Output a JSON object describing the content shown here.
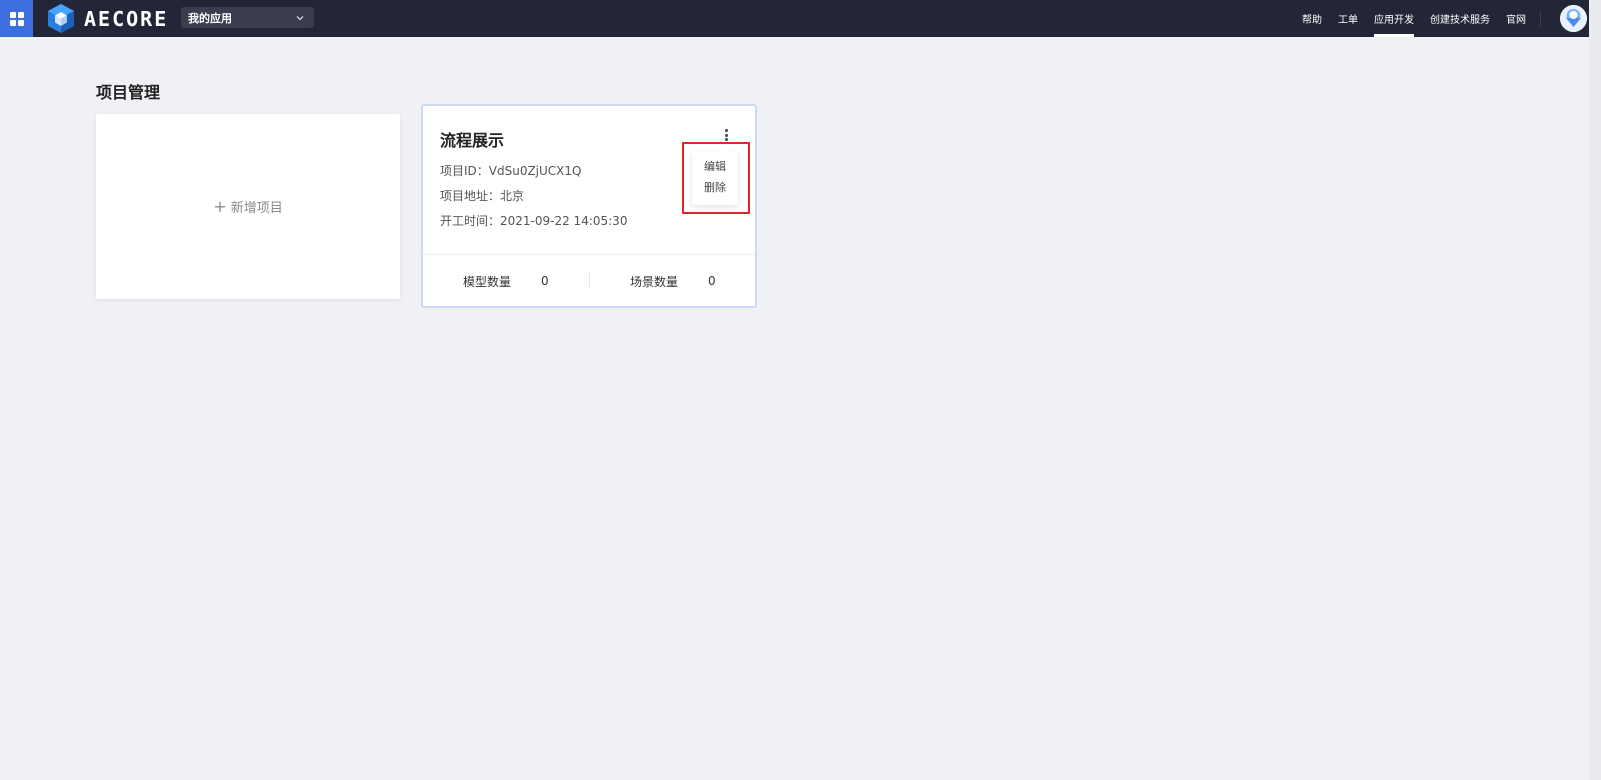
{
  "topbar": {
    "app_name": "AECORE",
    "app_select": {
      "value": "我的应用"
    },
    "nav": [
      {
        "label": "帮助"
      },
      {
        "label": "工单"
      },
      {
        "label": "应用开发",
        "active": true
      },
      {
        "label": "创建技术服务"
      },
      {
        "label": "官网"
      }
    ],
    "accent_color": "#3e6fe0",
    "bar_color": "#232637"
  },
  "main": {
    "title": "项目管理",
    "new_project_label": "新增项目",
    "project": {
      "name": "流程展示",
      "id_line": "项目ID：VdSu0ZjUCX1Q",
      "address_line": "项目地址：北京",
      "start_line": "开工时间：2021-09-22 14:05:30",
      "stats": [
        {
          "label": "模型数量",
          "value": "0"
        },
        {
          "label": "场景数量",
          "value": "0"
        }
      ],
      "menu": [
        {
          "label": "编辑"
        },
        {
          "label": "删除"
        }
      ]
    }
  }
}
